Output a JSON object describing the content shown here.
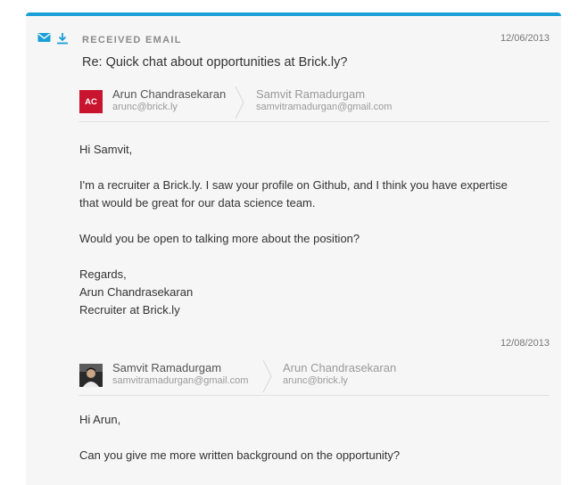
{
  "header": {
    "type_label": "Received Email",
    "date": "12/06/2013",
    "subject": "Re: Quick chat about opportunities at Brick.ly?",
    "icons": [
      "mail-icon",
      "download-icon"
    ],
    "accent_color": "#1a9fd8"
  },
  "message1": {
    "from": {
      "initials": "AC",
      "name": "Arun Chandrasekaran",
      "email": "arunc@brick.ly",
      "avatar_color": "#c8142f"
    },
    "to": {
      "name": "Samvit Ramadurgam",
      "email": "samvitramadurgan@gmail.com"
    },
    "greeting": "Hi Samvit,",
    "para1_line1": "I'm a recruiter a Brick.ly. I saw your profile on Github, and I think you have expertise",
    "para1_line2": "that would be great for our data science team.",
    "para2": "Would you be open to talking more about the position?",
    "closing": "Regards,",
    "sig_name": "Arun Chandrasekaran",
    "sig_title": "Recruiter at Brick.ly"
  },
  "message2": {
    "date": "12/08/2013",
    "from": {
      "name": "Samvit Ramadurgam",
      "email": "samvitramadurgan@gmail.com"
    },
    "to": {
      "name": "Arun Chandrasekaran",
      "email": "arunc@brick.ly"
    },
    "greeting": "Hi Arun,",
    "para1": "Can you give me more written background on the opportunity?"
  }
}
